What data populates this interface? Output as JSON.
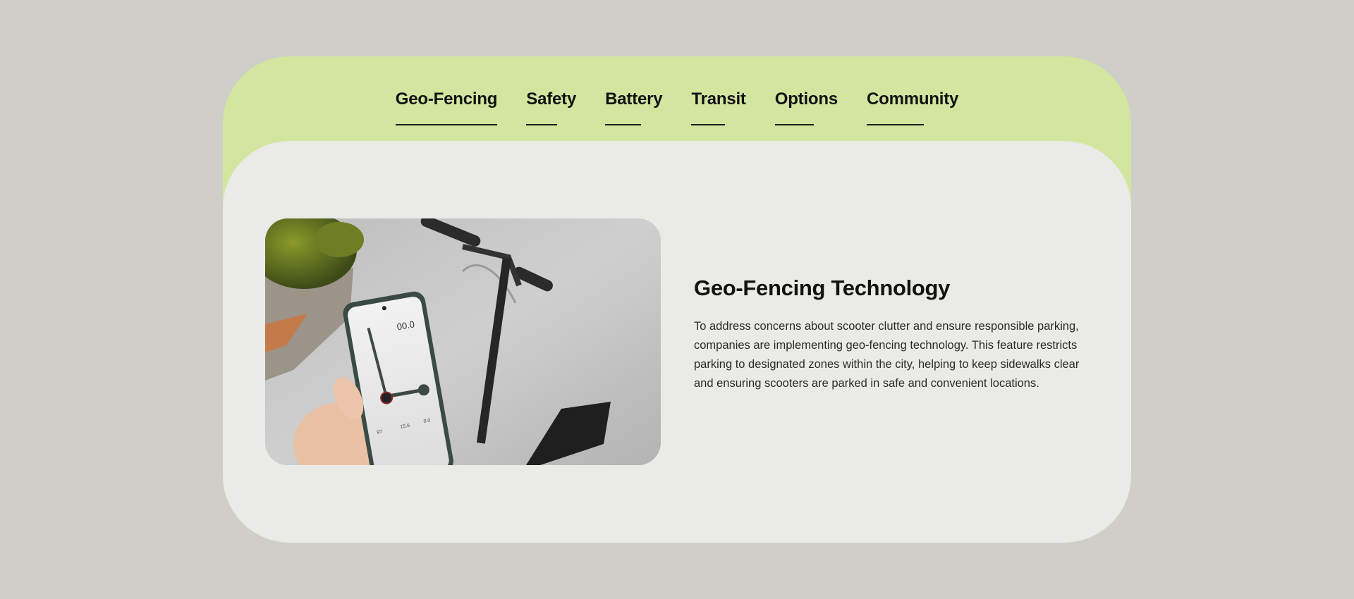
{
  "nav": {
    "tabs": [
      {
        "label": "Geo-Fencing"
      },
      {
        "label": "Safety"
      },
      {
        "label": "Battery"
      },
      {
        "label": "Transit"
      },
      {
        "label": "Options"
      },
      {
        "label": "Community"
      }
    ]
  },
  "feature": {
    "title": "Geo-Fencing Technology",
    "description": "To address concerns about scooter clutter and ensure responsible parking, companies are implementing geo-fencing technology. This feature restricts parking to designated zones within the city, helping to keep sidewalks clear and ensuring scooters are parked in safe and convenient locations.",
    "image": {
      "phone_speed": "00.0",
      "phone_stat_1": "97",
      "phone_stat_2": "15.6",
      "phone_stat_3": "0.0"
    }
  },
  "colors": {
    "page_background": "#cfcec9",
    "accent_green": "#d2e6a0",
    "panel_background": "#eaeae6",
    "text": "#121212"
  }
}
